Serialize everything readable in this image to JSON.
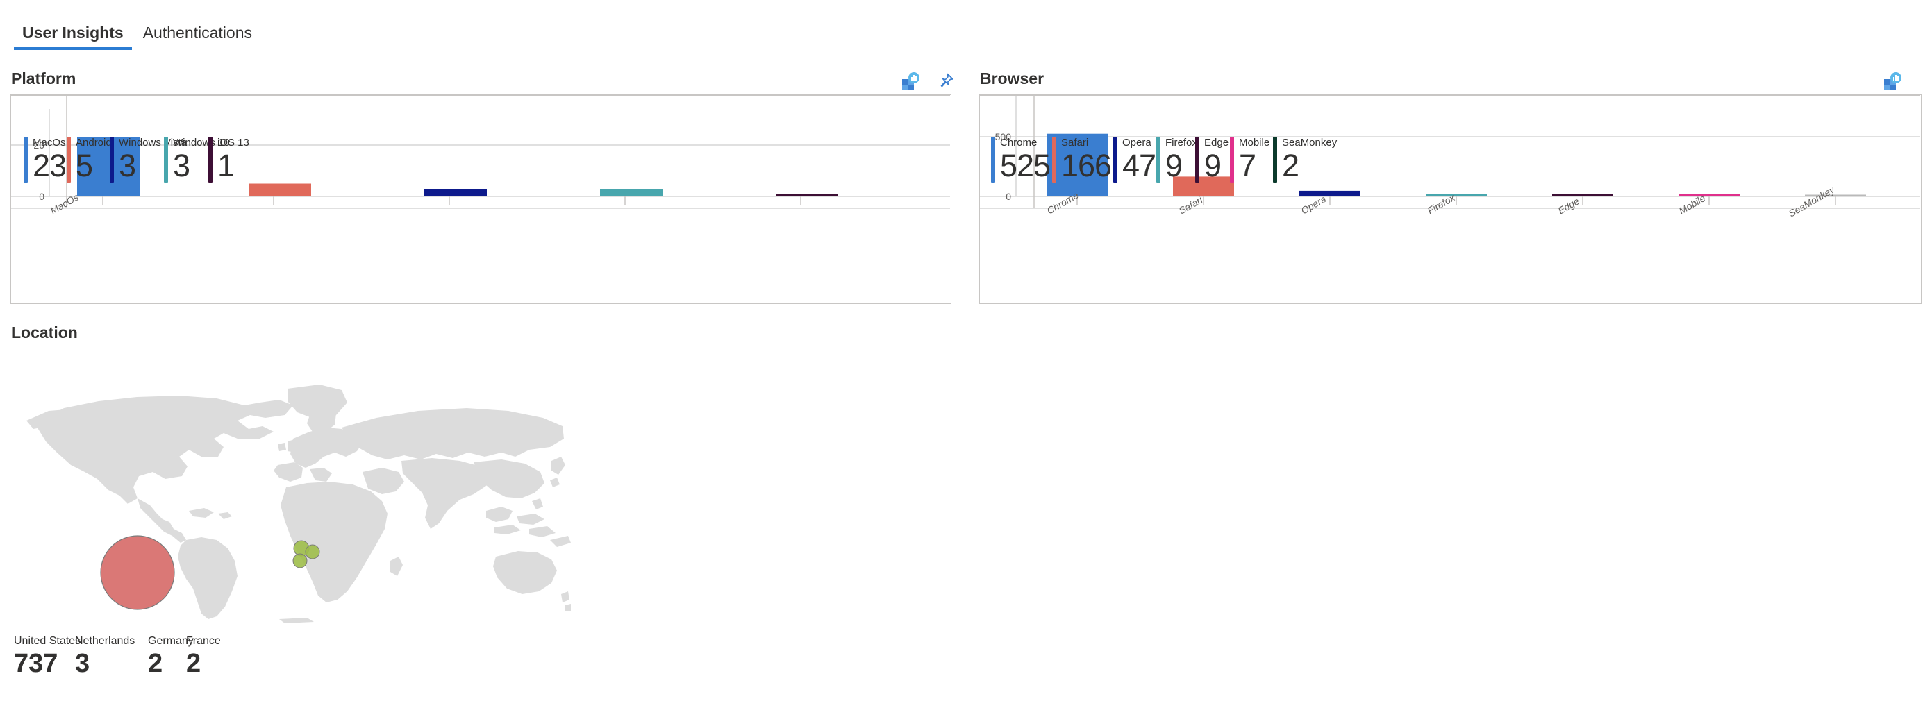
{
  "tabs": [
    {
      "label": "User Insights",
      "active": true
    },
    {
      "label": "Authentications",
      "active": false
    }
  ],
  "platform": {
    "title": "Platform",
    "icons": [
      {
        "name": "chart-tile-icon",
        "label": "chart-tile-icon"
      },
      {
        "name": "pin-icon",
        "label": "pin-icon"
      }
    ],
    "kpis": [
      {
        "label": "MacOs",
        "value": "23",
        "color": "#3a7ed0"
      },
      {
        "label": "Android",
        "value": "5",
        "color": "#e0695a"
      },
      {
        "label": "Windows Vista",
        "value": "3",
        "color": "#0d1a8c"
      },
      {
        "label": "Windows 10",
        "value": "3",
        "color": "#48a6ad"
      },
      {
        "label": "iOS 13",
        "value": "1",
        "color": "#3d0f35"
      }
    ]
  },
  "browser": {
    "title": "Browser",
    "icons": [
      {
        "name": "chart-tile-icon",
        "label": "chart-tile-icon"
      }
    ],
    "kpis": [
      {
        "label": "Chrome",
        "value": "525",
        "color": "#3a7ed0"
      },
      {
        "label": "Safari",
        "value": "166",
        "color": "#e0695a"
      },
      {
        "label": "Opera",
        "value": "47",
        "color": "#0d1a8c"
      },
      {
        "label": "Firefox",
        "value": "9",
        "color": "#48a6ad"
      },
      {
        "label": "Edge",
        "value": "9",
        "color": "#3d0f35"
      },
      {
        "label": "Mobile",
        "value": "7",
        "color": "#e0308c"
      },
      {
        "label": "SeaMonkey",
        "value": "2",
        "color": "#0c3a2c"
      }
    ]
  },
  "location": {
    "title": "Location",
    "kpis": [
      {
        "label": "United States",
        "value": "737"
      },
      {
        "label": "Netherlands",
        "value": "3"
      },
      {
        "label": "Germany",
        "value": "2"
      },
      {
        "label": "France",
        "value": "2"
      }
    ],
    "bubbles": [
      {
        "country": "United States",
        "value": 737,
        "color": "#d4605e",
        "cx": 176,
        "cy": 285,
        "r": 53
      },
      {
        "country": "Netherlands",
        "value": 3,
        "color": "#9fbe4a",
        "cx": 412,
        "cy": 250,
        "r": 11
      },
      {
        "country": "Germany",
        "value": 2,
        "color": "#9fbe4a",
        "cx": 428,
        "cy": 255,
        "r": 10
      },
      {
        "country": "France",
        "value": 2,
        "color": "#9fbe4a",
        "cx": 410,
        "cy": 268,
        "r": 10
      }
    ],
    "map_land_color": "#dcdcdc"
  },
  "chart_data": [
    {
      "type": "bar",
      "title": "Platform",
      "categories": [
        "MacOs",
        "Android",
        "Windows Vista",
        "Windows 10",
        "iOS 13"
      ],
      "values": [
        23,
        5,
        3,
        3,
        1
      ],
      "colors": [
        "#3a7ed0",
        "#e0695a",
        "#0d1a8c",
        "#48a6ad",
        "#3d0f35"
      ],
      "xlabel": "",
      "ylabel": "",
      "yticks": [
        0,
        20
      ],
      "ylim": [
        0,
        26
      ],
      "visible_xticklabels": [
        "MacOs"
      ],
      "grid": true,
      "legend": "bottom-kpi-strip"
    },
    {
      "type": "bar",
      "title": "Browser",
      "categories": [
        "Chrome",
        "Safari",
        "Opera",
        "Firefox",
        "Edge",
        "Mobile",
        "SeaMonkey"
      ],
      "values": [
        525,
        166,
        47,
        9,
        9,
        7,
        2
      ],
      "colors": [
        "#3a7ed0",
        "#e0695a",
        "#0d1a8c",
        "#48a6ad",
        "#3d0f35",
        "#e0308c",
        "#b9b9b9"
      ],
      "xlabel": "",
      "ylabel": "",
      "yticks": [
        0,
        500
      ],
      "ylim": [
        0,
        600
      ],
      "visible_xticklabels": [
        "Chrome",
        "Safari",
        "Opera",
        "Firefox",
        "Edge",
        "Mobile",
        "SeaMonkey"
      ],
      "grid": true,
      "legend": "bottom-kpi-strip"
    },
    {
      "type": "map",
      "title": "Location",
      "categories": [
        "United States",
        "Netherlands",
        "Germany",
        "France"
      ],
      "values": [
        737,
        3,
        2,
        2
      ],
      "colors": [
        "#d4605e",
        "#9fbe4a",
        "#9fbe4a",
        "#9fbe4a"
      ]
    }
  ],
  "colors": {
    "accent": "#2b7cd3",
    "card_border": "#c8c6c4",
    "grid": "#d6d6d6",
    "text": "#323130",
    "axis_text": "#605e5c"
  }
}
